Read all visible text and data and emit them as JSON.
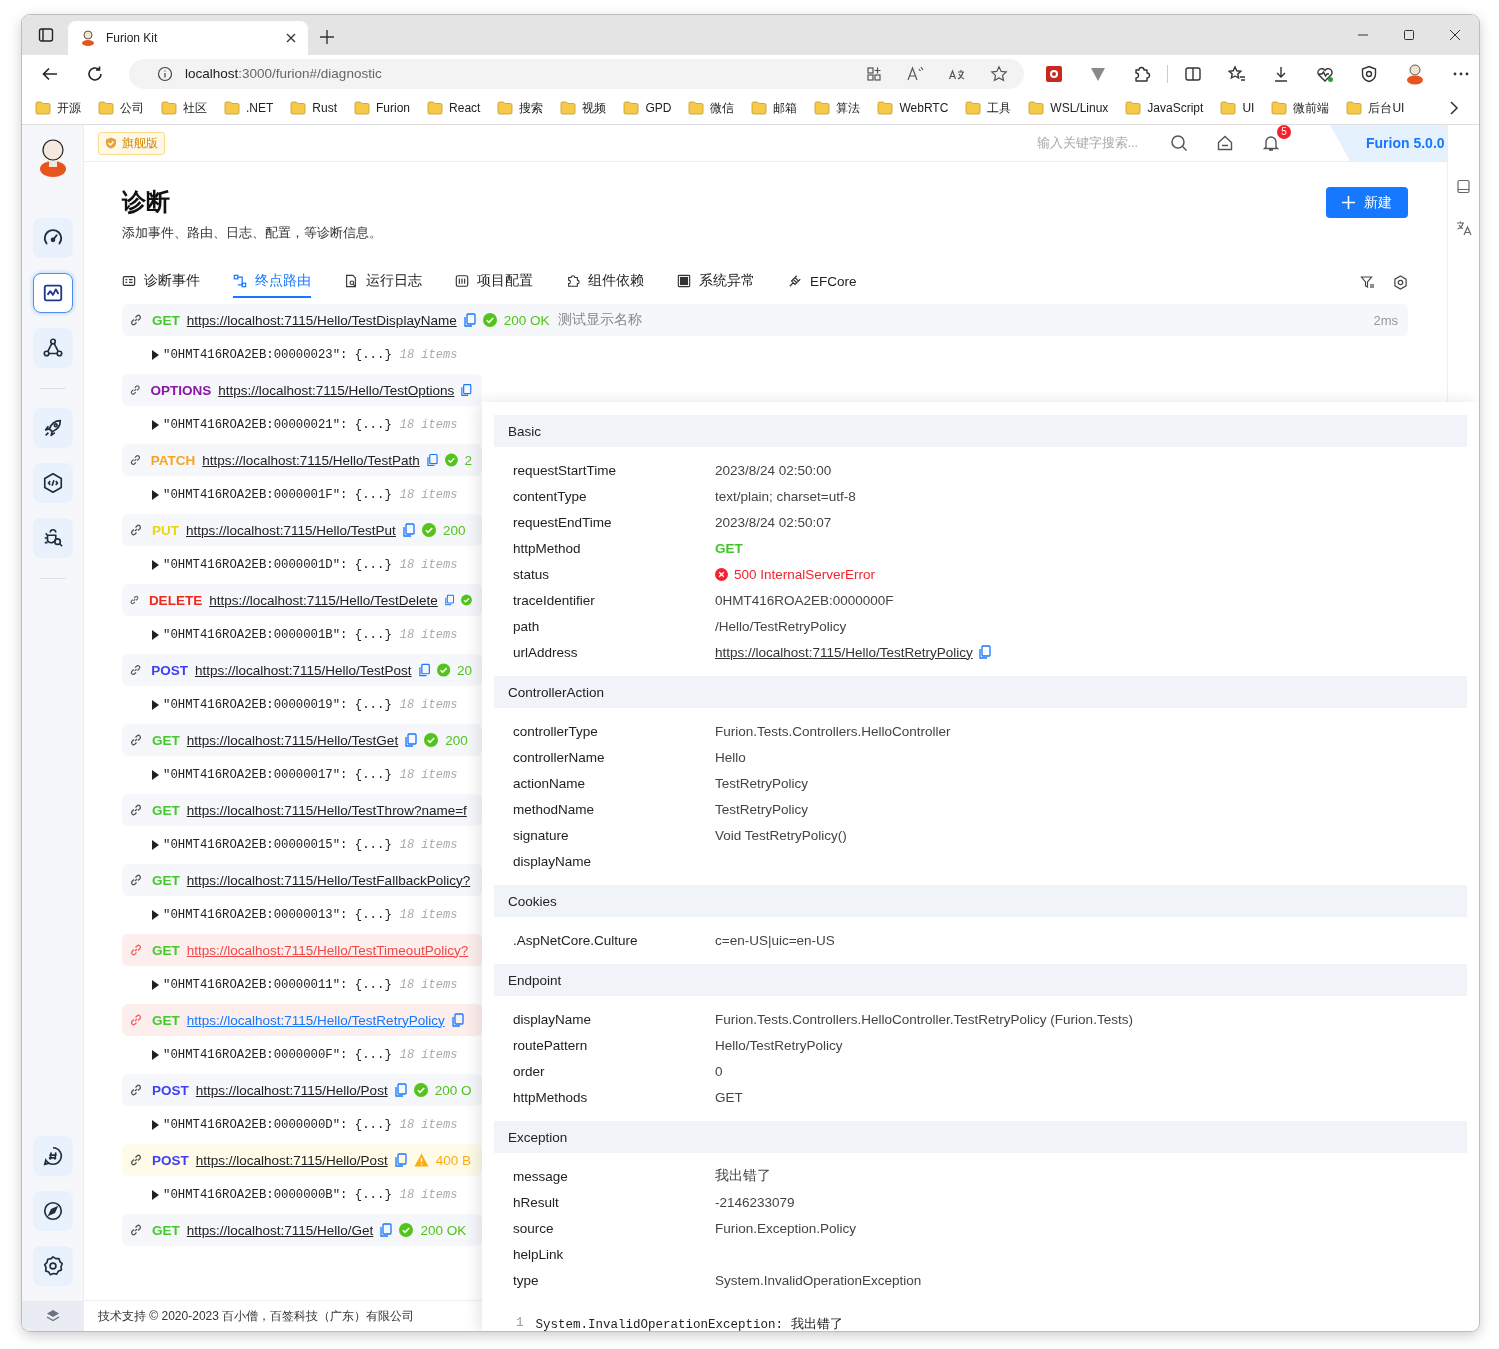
{
  "browser": {
    "tab_title": "Furion Kit",
    "url_host": "localhost",
    "url_rest": ":3000/furion#/diagnostic",
    "bookmarks": [
      "开源",
      "公司",
      "社区",
      ".NET",
      "Rust",
      "Furion",
      "React",
      "搜索",
      "视频",
      "GPD",
      "微信",
      "邮箱",
      "算法",
      "WebRTC",
      "工具",
      "WSL/Linux",
      "JavaScript",
      "UI",
      "微前端",
      "后台UI"
    ]
  },
  "sidebar": {
    "groups": [
      [
        {
          "selected": false
        },
        {
          "selected": true
        },
        {
          "selected": false
        }
      ],
      [
        {
          "selected": false
        },
        {
          "selected": false
        },
        {
          "selected": false
        }
      ]
    ],
    "tools": [
      {
        "selected": false
      },
      {
        "selected": false
      },
      {
        "selected": false
      }
    ]
  },
  "header": {
    "edition": "旗舰版",
    "search_placeholder": "输入关键字搜索...",
    "notifications": "5",
    "version": "Furion 5.0.0"
  },
  "page": {
    "title": "诊断",
    "subtitle": "添加事件、路由、日志、配置，等诊断信息。",
    "new_button": "新建"
  },
  "tabs": [
    {
      "label": "诊断事件",
      "selected": false
    },
    {
      "label": "终点路由",
      "selected": true
    },
    {
      "label": "运行日志",
      "selected": false
    },
    {
      "label": "项目配置",
      "selected": false
    },
    {
      "label": "组件依赖",
      "selected": false
    },
    {
      "label": "系统异常",
      "selected": false
    },
    {
      "label": "EFCore",
      "selected": false
    }
  ],
  "requests": [
    {
      "method": "GET",
      "color": "#44c92d",
      "url": "https://localhost:7115/Hello/TestDisplayName",
      "copyable": true,
      "status_icon": true,
      "status": "200 OK",
      "description": "测试显示名称",
      "duration": "2ms",
      "kind": "normal",
      "selected": false,
      "entry": "\"0HMT416ROA2EB:00000023\": {...}",
      "count": "18 items"
    },
    {
      "method": "OPTIONS",
      "color": "#8a15a8",
      "url": "https://localhost:7115/Hello/TestOptions",
      "copyable": true,
      "status_icon": false,
      "kind": "normal",
      "selected": false,
      "entry": "\"0HMT416ROA2EB:00000021\": {...}",
      "count": "18 items"
    },
    {
      "method": "PATCH",
      "color": "#f5a524",
      "url": "https://localhost:7115/Hello/TestPath",
      "copyable": true,
      "status_icon": true,
      "status": "2",
      "kind": "normal",
      "selected": false,
      "entry": "\"0HMT416ROA2EB:0000001F\": {...}",
      "count": "18 items"
    },
    {
      "method": "PUT",
      "color": "#e8d70a",
      "url": "https://localhost:7115/Hello/TestPut",
      "copyable": true,
      "status_icon": true,
      "status": "200",
      "kind": "normal",
      "selected": false,
      "entry": "\"0HMT416ROA2EB:0000001D\": {...}",
      "count": "18 items"
    },
    {
      "method": "DELETE",
      "color": "#f0281e",
      "url": "https://localhost:7115/Hello/TestDelete",
      "copyable": true,
      "status_icon": true,
      "kind": "normal",
      "selected": false,
      "entry": "\"0HMT416ROA2EB:0000001B\": {...}",
      "count": "18 items"
    },
    {
      "method": "POST",
      "color": "#3d3ff0",
      "url": "https://localhost:7115/Hello/TestPost",
      "copyable": true,
      "status_icon": true,
      "status": "20",
      "kind": "normal",
      "selected": false,
      "entry": "\"0HMT416ROA2EB:00000019\": {...}",
      "count": "18 items"
    },
    {
      "method": "GET",
      "color": "#44c92d",
      "url": "https://localhost:7115/Hello/TestGet",
      "copyable": true,
      "status_icon": true,
      "status": "200",
      "kind": "normal",
      "selected": false,
      "entry": "\"0HMT416ROA2EB:00000017\": {...}",
      "count": "18 items"
    },
    {
      "method": "GET",
      "color": "#44c92d",
      "url": "https://localhost:7115/Hello/TestThrow?name=f",
      "copyable": false,
      "status_icon": false,
      "kind": "normal",
      "selected": false,
      "entry": "\"0HMT416ROA2EB:00000015\": {...}",
      "count": "18 items"
    },
    {
      "method": "GET",
      "color": "#44c92d",
      "url": "https://localhost:7115/Hello/TestFallbackPolicy?",
      "copyable": false,
      "status_icon": false,
      "kind": "normal",
      "selected": false,
      "entry": "\"0HMT416ROA2EB:00000013\": {...}",
      "count": "18 items"
    },
    {
      "method": "GET",
      "color": "#44c92d",
      "url": "https://localhost:7115/Hello/TestTimeoutPolicy?",
      "copyable": false,
      "status_icon": false,
      "kind": "error",
      "selected": false,
      "entry": "\"0HMT416ROA2EB:00000011\": {...}",
      "count": "18 items"
    },
    {
      "method": "GET",
      "color": "#44c92d",
      "url": "https://localhost:7115/Hello/TestRetryPolicy",
      "copyable": true,
      "status_icon": false,
      "kind": "error",
      "selected": true,
      "entry": "\"0HMT416ROA2EB:0000000F\": {...}",
      "count": "18 items"
    },
    {
      "method": "POST",
      "color": "#3d3ff0",
      "url": "https://localhost:7115/Hello/Post",
      "copyable": true,
      "status_icon": true,
      "status": "200 O",
      "kind": "normal",
      "selected": false,
      "entry": "\"0HMT416ROA2EB:0000000D\": {...}",
      "count": "18 items"
    },
    {
      "method": "POST",
      "color": "#3d3ff0",
      "url": "https://localhost:7115/Hello/Post",
      "copyable": true,
      "status_icon": true,
      "status": "400 B",
      "kind": "warning",
      "selected": false,
      "entry": "\"0HMT416ROA2EB:0000000B\": {...}",
      "count": "18 items"
    },
    {
      "method": "GET",
      "color": "#44c92d",
      "url": "https://localhost:7115/Hello/Get",
      "copyable": true,
      "status_icon": true,
      "status": "200 OK",
      "kind": "normal",
      "selected": false
    }
  ],
  "detail": {
    "sections": [
      {
        "title": "Basic",
        "rows": [
          {
            "key": "requestStartTime",
            "value": "2023/8/24 02:50:00",
            "kind": "text"
          },
          {
            "key": "contentType",
            "value": "text/plain; charset=utf-8",
            "kind": "text"
          },
          {
            "key": "requestEndTime",
            "value": "2023/8/24 02:50:07",
            "kind": "text"
          },
          {
            "key": "httpMethod",
            "value": "GET",
            "kind": "method"
          },
          {
            "key": "status",
            "value": "500 InternalServerError",
            "kind": "status"
          },
          {
            "key": "traceIdentifier",
            "value": "0HMT416ROA2EB:0000000F",
            "kind": "text"
          },
          {
            "key": "path",
            "value": "/Hello/TestRetryPolicy",
            "kind": "text"
          },
          {
            "key": "urlAddress",
            "value": "https://localhost:7115/Hello/TestRetryPolicy",
            "kind": "link"
          }
        ]
      },
      {
        "title": "ControllerAction",
        "rows": [
          {
            "key": "controllerType",
            "value": "Furion.Tests.Controllers.HelloController",
            "kind": "text"
          },
          {
            "key": "controllerName",
            "value": "Hello",
            "kind": "text"
          },
          {
            "key": "actionName",
            "value": "TestRetryPolicy",
            "kind": "text"
          },
          {
            "key": "methodName",
            "value": "TestRetryPolicy",
            "kind": "text"
          },
          {
            "key": "signature",
            "value": "Void TestRetryPolicy()",
            "kind": "text"
          },
          {
            "key": "displayName"
          }
        ]
      },
      {
        "title": "Cookies",
        "rows": [
          {
            "key": ".AspNetCore.Culture",
            "value": "c=en-US|uic=en-US",
            "kind": "text"
          }
        ]
      },
      {
        "title": "Endpoint",
        "rows": [
          {
            "key": "displayName",
            "value": "Furion.Tests.Controllers.HelloController.TestRetryPolicy (Furion.Tests)",
            "kind": "text"
          },
          {
            "key": "routePattern",
            "value": "Hello/TestRetryPolicy",
            "kind": "text"
          },
          {
            "key": "order",
            "value": "0",
            "kind": "text"
          },
          {
            "key": "httpMethods",
            "value": "GET",
            "kind": "text"
          }
        ]
      },
      {
        "title": "Exception",
        "rows": [
          {
            "key": "message",
            "value": "我出错了",
            "kind": "text"
          },
          {
            "key": "hResult",
            "value": "-2146233079",
            "kind": "text"
          },
          {
            "key": "source",
            "value": "Furion.Exception.Policy",
            "kind": "text"
          },
          {
            "key": "helpLink"
          },
          {
            "key": "type",
            "value": "System.InvalidOperationException",
            "kind": "text"
          }
        ]
      }
    ],
    "code_lines": [
      {
        "number": "1",
        "text": "System.InvalidOperationException: 我出错了"
      }
    ]
  },
  "footer": "技术支持 © 2020-2023 百小僧，百签科技（广东）有限公司"
}
